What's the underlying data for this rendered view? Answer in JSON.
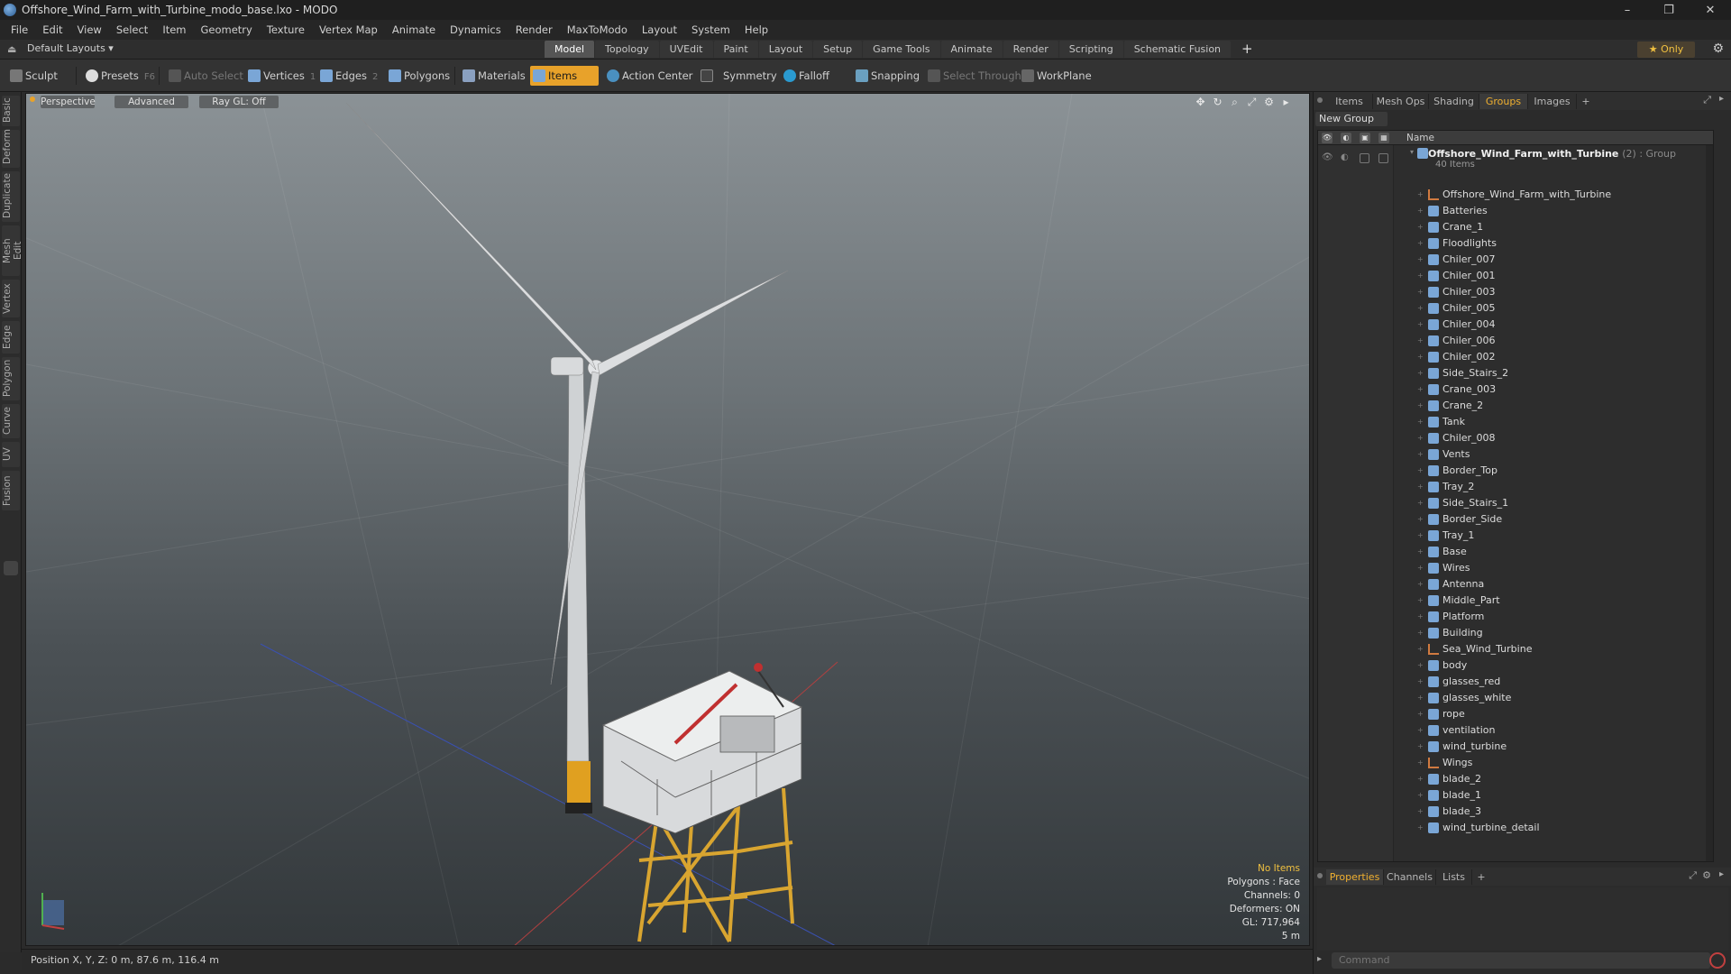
{
  "window": {
    "title": "Offshore_Wind_Farm_with_Turbine_modo_base.lxo - MODO",
    "controls": [
      "–",
      "❐",
      "✕"
    ]
  },
  "menu": [
    "File",
    "Edit",
    "View",
    "Select",
    "Item",
    "Geometry",
    "Texture",
    "Vertex Map",
    "Animate",
    "Dynamics",
    "Render",
    "MaxToModo",
    "Layout",
    "System",
    "Help"
  ],
  "layoutbar": {
    "layout_dropdown": "Default Layouts ▾",
    "mode_tabs": [
      "Model",
      "Topology",
      "UVEdit",
      "Paint",
      "Layout",
      "Setup",
      "Game Tools",
      "Animate",
      "Render",
      "Scripting",
      "Schematic Fusion"
    ],
    "active_mode": "Model",
    "add_tab": "+",
    "only_label": "★ Only"
  },
  "toolbar": {
    "sculpt": "Sculpt",
    "presets": "Presets",
    "presets_shortcut": "F6",
    "auto_select": "Auto Select",
    "vertices": "Vertices",
    "vertices_shortcut": "1",
    "edges": "Edges",
    "edges_shortcut": "2",
    "polygons": "Polygons",
    "materials": "Materials",
    "items": "Items",
    "action_center": "Action Center",
    "symmetry": "Symmetry",
    "falloff": "Falloff",
    "snapping": "Snapping",
    "select_through": "Select Through",
    "workplane": "WorkPlane"
  },
  "left_tabs": [
    "Basic",
    "Deform",
    "Duplicate",
    "Mesh Edit",
    "Vertex",
    "Edge",
    "Polygon",
    "Curve",
    "UV",
    "Fusion"
  ],
  "viewport": {
    "view_mode": "Perspective",
    "shading": "Advanced",
    "raygl": "Ray GL: Off",
    "hud": {
      "selection": "No Items",
      "polygons": "Polygons : Face",
      "channels": "Channels: 0",
      "deformers": "Deformers: ON",
      "gl": "GL: 717,964",
      "scale": "5 m"
    }
  },
  "status": {
    "position": "Position X, Y, Z:  0 m, 87.6 m, 116.4 m"
  },
  "right_panel": {
    "tabs": [
      "Items",
      "Mesh Ops",
      "Shading",
      "Groups",
      "Images"
    ],
    "active_tab": "Groups",
    "add_tab": "+",
    "new_group": "New Group",
    "column_name": "Name",
    "group": {
      "name": "Offshore_Wind_Farm_with_Turbine",
      "type": "(2) : Group",
      "count": "40 Items"
    },
    "items": [
      {
        "label": "Offshore_Wind_Farm_with_Turbine",
        "icon": "locator-icon"
      },
      {
        "label": "Batteries",
        "icon": "mesh-icon"
      },
      {
        "label": "Crane_1",
        "icon": "mesh-icon"
      },
      {
        "label": "Floodlights",
        "icon": "mesh-icon"
      },
      {
        "label": "Chiler_007",
        "icon": "mesh-icon"
      },
      {
        "label": "Chiler_001",
        "icon": "mesh-icon"
      },
      {
        "label": "Chiler_003",
        "icon": "mesh-icon"
      },
      {
        "label": "Chiler_005",
        "icon": "mesh-icon"
      },
      {
        "label": "Chiler_004",
        "icon": "mesh-icon"
      },
      {
        "label": "Chiler_006",
        "icon": "mesh-icon"
      },
      {
        "label": "Chiler_002",
        "icon": "mesh-icon"
      },
      {
        "label": "Side_Stairs_2",
        "icon": "mesh-icon"
      },
      {
        "label": "Crane_003",
        "icon": "mesh-icon"
      },
      {
        "label": "Crane_2",
        "icon": "mesh-icon"
      },
      {
        "label": "Tank",
        "icon": "mesh-icon"
      },
      {
        "label": "Chiler_008",
        "icon": "mesh-icon"
      },
      {
        "label": "Vents",
        "icon": "mesh-icon"
      },
      {
        "label": "Border_Top",
        "icon": "mesh-icon"
      },
      {
        "label": "Tray_2",
        "icon": "mesh-icon"
      },
      {
        "label": "Side_Stairs_1",
        "icon": "mesh-icon"
      },
      {
        "label": "Border_Side",
        "icon": "mesh-icon"
      },
      {
        "label": "Tray_1",
        "icon": "mesh-icon"
      },
      {
        "label": "Base",
        "icon": "mesh-icon"
      },
      {
        "label": "Wires",
        "icon": "mesh-icon"
      },
      {
        "label": "Antenna",
        "icon": "mesh-icon"
      },
      {
        "label": "Middle_Part",
        "icon": "mesh-icon"
      },
      {
        "label": "Platform",
        "icon": "mesh-icon"
      },
      {
        "label": "Building",
        "icon": "mesh-icon"
      },
      {
        "label": "Sea_Wind_Turbine",
        "icon": "locator-icon"
      },
      {
        "label": "body",
        "icon": "mesh-icon"
      },
      {
        "label": "glasses_red",
        "icon": "mesh-icon"
      },
      {
        "label": "glasses_white",
        "icon": "mesh-icon"
      },
      {
        "label": "rope",
        "icon": "mesh-icon"
      },
      {
        "label": "ventilation",
        "icon": "mesh-icon"
      },
      {
        "label": "wind_turbine",
        "icon": "mesh-icon"
      },
      {
        "label": "Wings",
        "icon": "locator-icon"
      },
      {
        "label": "blade_2",
        "icon": "mesh-icon"
      },
      {
        "label": "blade_1",
        "icon": "mesh-icon"
      },
      {
        "label": "blade_3",
        "icon": "mesh-icon"
      },
      {
        "label": "wind_turbine_detail",
        "icon": "mesh-icon"
      }
    ],
    "bottom_tabs": [
      "Properties",
      "Channels",
      "Lists"
    ],
    "bottom_active": "Properties",
    "command_placeholder": "Command"
  },
  "colors": {
    "accent_orange": "#e8a22a",
    "active_tab_text": "#f0b030",
    "mesh_icon": "#7aa6d6",
    "locator_icon": "#d07a40"
  }
}
